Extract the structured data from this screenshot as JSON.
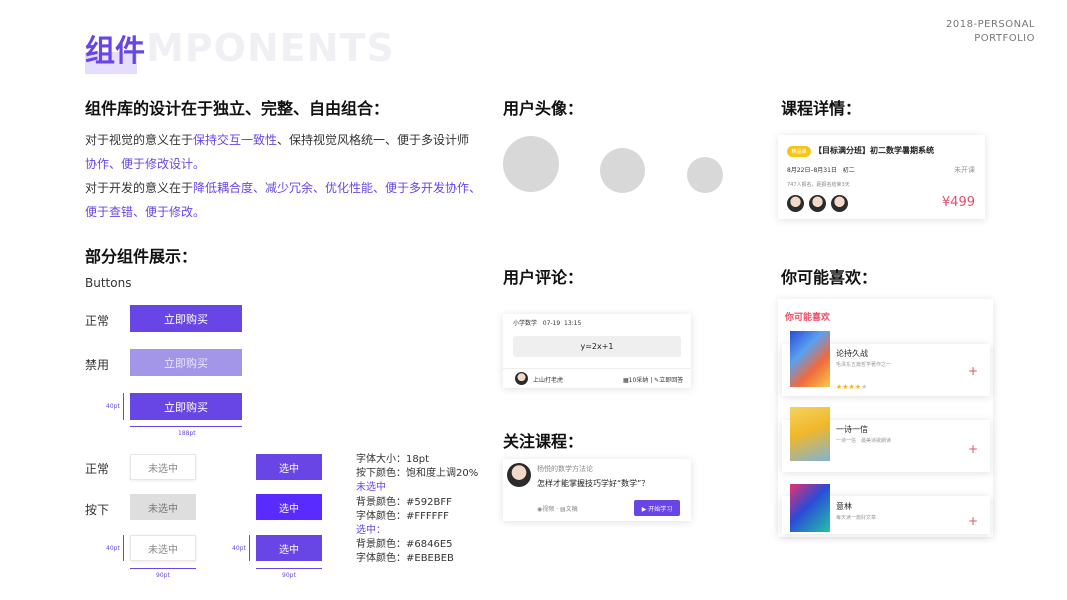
{
  "header": {
    "title_cn": "组件",
    "title_en": "MPONENTS",
    "corner_line1": "2018-PERSONAL",
    "corner_line2": "PORTFOLIO"
  },
  "intro": {
    "heading": "组件库的设计在于独立、完整、自由组合：",
    "p1_a": "对于视觉的意义在于",
    "p1_hl1": "保持交互一致性",
    "p1_b": "、保持视觉风格统一、便于多设计师",
    "p1_hl2": "协作、便于修改设计。",
    "p2_a": "对于开发的意义在于",
    "p2_hl1": "降低耦合度、减少冗余、优化性能、便于多开发协作、",
    "p2_hl2": "便于查错、便于修改。"
  },
  "showcase": {
    "heading": "部分组件展示：",
    "buttons_label": "Buttons",
    "state_normal": "正常",
    "state_disabled": "禁用",
    "buy_label": "立即购买",
    "dim_h_big": "40pt",
    "dim_w_big": "188pt",
    "state_normal2": "正常",
    "state_pressed": "按下",
    "unselected": "未选中",
    "selected": "选中",
    "dim_h_small": "40pt",
    "dim_w_small": "90pt"
  },
  "spec": {
    "l1": "字体大小：18pt",
    "l2": "按下颜色：饱和度上调20%",
    "l3": "未选中",
    "l4": "背景颜色：#592BFF",
    "l5": "字体颜色：#FFFFFF",
    "l6": "选中：",
    "l7": "背景颜色：#6846E5",
    "l8": "字体颜色：#EBEBEB"
  },
  "avatar_section": {
    "heading": "用户头像："
  },
  "comment_section": {
    "heading": "用户评论：",
    "subject": "小学数学",
    "date": "07-19",
    "time": "13:15",
    "formula": "y=2x+1",
    "user": "上山打老虎",
    "stats": "10采纳",
    "action": "立即回答"
  },
  "follow_section": {
    "heading": "关注课程：",
    "author": "杨悦的数学方法论",
    "question": "怎样才能掌握技巧学好“数学”？",
    "tag_video": "视频",
    "tag_doc": "文稿",
    "start_btn": "▶ 开始学习"
  },
  "course_section": {
    "heading": "课程详情：",
    "badge": "精品课",
    "title": "【目标满分班】初二数学暑期系统",
    "date_range": "8月22日–8月31日",
    "grade": "初二",
    "status": "未开课",
    "enrolled": "747人报名，距报名结束3天",
    "price": "¥499"
  },
  "like_section": {
    "heading": "你可能喜欢：",
    "card_title": "你可能喜欢",
    "items": [
      {
        "title": "论持久战",
        "desc": "毛泽东五篇哲学著作之一"
      },
      {
        "title": "一诗一信",
        "desc": "一诗一信　最美诗歌朗读"
      },
      {
        "title": "意林",
        "desc": "每天读一篇好文章"
      }
    ]
  },
  "colors": {
    "accent": "#6846E5",
    "pressed": "#592BFF",
    "price": "#e84d6a"
  }
}
